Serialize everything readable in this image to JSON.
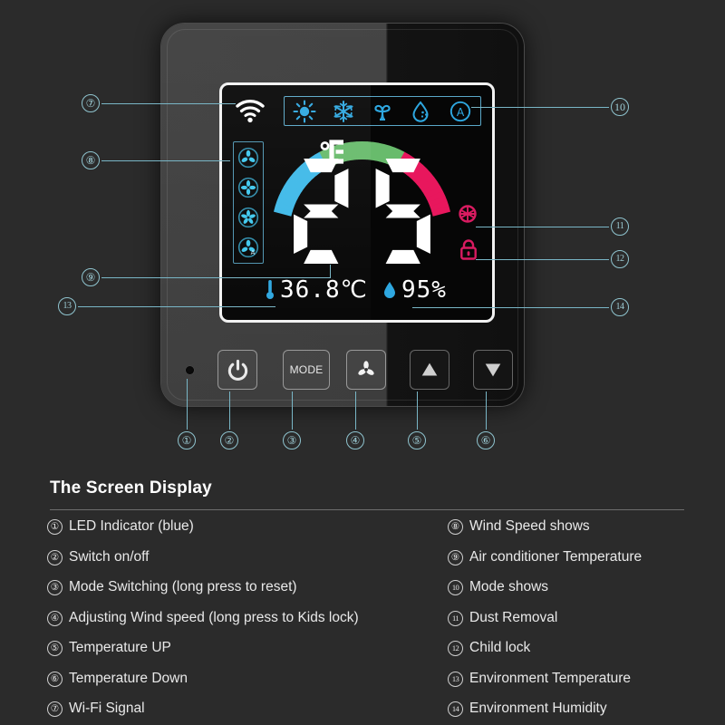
{
  "device": {
    "screen": {
      "wifi_icon": "wifi-icon",
      "mode_icons": [
        {
          "name": "heat-sun-icon",
          "label": "Heat"
        },
        {
          "name": "cool-snowflake-icon",
          "label": "Cool"
        },
        {
          "name": "fan-icon",
          "label": "Fan"
        },
        {
          "name": "dry-droplet-icon",
          "label": "Dry"
        },
        {
          "name": "auto-icon",
          "label": "A"
        }
      ],
      "fan_speed_icons": [
        {
          "name": "fan-speed-1-icon",
          "label": "Low"
        },
        {
          "name": "fan-speed-2-icon",
          "label": "Medium"
        },
        {
          "name": "fan-speed-3-icon",
          "label": "High"
        },
        {
          "name": "fan-speed-auto-icon",
          "label": "Auto"
        }
      ],
      "set_temperature": "25",
      "unit": "℃",
      "env_temperature": "36.8℃",
      "env_humidity": "95%",
      "dust_removal_icon": "dust-removal-icon",
      "child_lock_icon": "child-lock-icon",
      "gauge": {
        "segments_total": 44,
        "color_blue": "#3fb9e8",
        "color_green": "#68bb6c",
        "color_pink": "#e8175d",
        "blue_count": 14,
        "green_count": 16,
        "pink_count": 14
      },
      "accent_blue": "#2ea7e0",
      "accent_pink": "#d81b60"
    },
    "buttons": [
      {
        "name": "power-button",
        "label": "",
        "icon": "power-icon"
      },
      {
        "name": "mode-button",
        "label": "MODE",
        "icon": ""
      },
      {
        "name": "fan-button",
        "label": "",
        "icon": "fan-icon"
      },
      {
        "name": "temp-up-button",
        "label": "",
        "icon": "triangle-up-icon"
      },
      {
        "name": "temp-down-button",
        "label": "",
        "icon": "triangle-down-icon"
      }
    ],
    "led_indicator": "led-indicator"
  },
  "callouts": [
    {
      "n": "①"
    },
    {
      "n": "②"
    },
    {
      "n": "③"
    },
    {
      "n": "④"
    },
    {
      "n": "⑤"
    },
    {
      "n": "⑥"
    },
    {
      "n": "⑦"
    },
    {
      "n": "⑧"
    },
    {
      "n": "⑨"
    },
    {
      "n": "10"
    },
    {
      "n": "11"
    },
    {
      "n": "12"
    },
    {
      "n": "13"
    },
    {
      "n": "14"
    }
  ],
  "legend": {
    "title": "The Screen Display",
    "left": [
      {
        "num": "①",
        "text": "LED Indicator (blue)"
      },
      {
        "num": "②",
        "text": "Switch on/off"
      },
      {
        "num": "③",
        "text": "Mode Switching (long press to reset)"
      },
      {
        "num": "④",
        "text": "Adjusting Wind speed (long press to Kids lock)"
      },
      {
        "num": "⑤",
        "text": "Temperature UP"
      },
      {
        "num": "⑥",
        "text": "Temperature Down"
      },
      {
        "num": "⑦",
        "text": "Wi-Fi Signal"
      }
    ],
    "right": [
      {
        "num": "⑧",
        "text": "Wind Speed shows"
      },
      {
        "num": "⑨",
        "text": "Air conditioner Temperature"
      },
      {
        "num": "10",
        "text": "Mode shows"
      },
      {
        "num": "11",
        "text": "Dust Removal"
      },
      {
        "num": "12",
        "text": "Child lock"
      },
      {
        "num": "13",
        "text": "Environment Temperature"
      },
      {
        "num": "14",
        "text": "Environment Humidity"
      }
    ]
  }
}
